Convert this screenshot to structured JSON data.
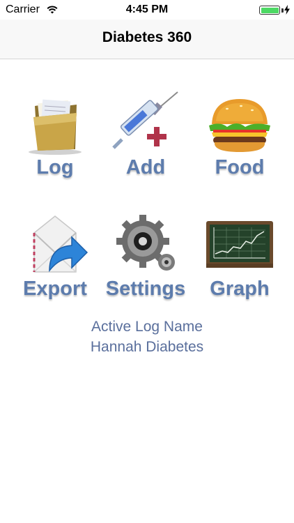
{
  "status_bar": {
    "carrier": "Carrier",
    "time": "4:45 PM"
  },
  "nav": {
    "title": "Diabetes 360"
  },
  "menu": {
    "log": "Log",
    "add": "Add",
    "food": "Food",
    "export": "Export",
    "settings": "Settings",
    "graph": "Graph"
  },
  "active_log": {
    "title": "Active Log Name",
    "name": "Hannah Diabetes"
  },
  "icons": [
    "folder-icon",
    "syringe-icon",
    "burger-icon",
    "envelope-icon",
    "gear-icon",
    "chalkboard-chart-icon"
  ],
  "colors": {
    "label": "#5d7cad",
    "active_log_text": "#5a6f9c",
    "battery": "#4cd964"
  }
}
